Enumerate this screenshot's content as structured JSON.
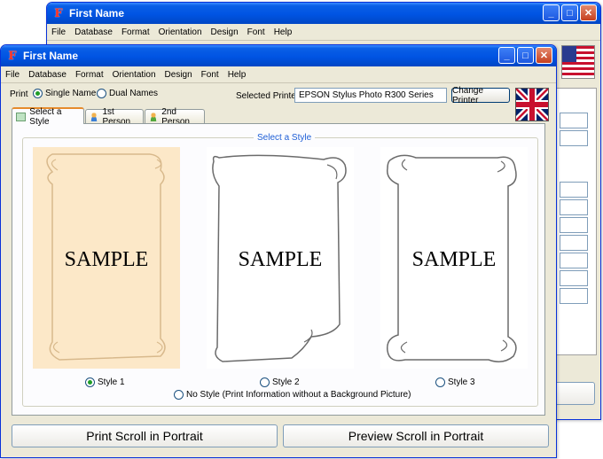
{
  "back_window": {
    "title": "First Name",
    "menu": [
      "File",
      "Database",
      "Format",
      "Orientation",
      "Design",
      "Font",
      "Help"
    ]
  },
  "front_window": {
    "title": "First Name",
    "menu": [
      "File",
      "Database",
      "Format",
      "Orientation",
      "Design",
      "Font",
      "Help"
    ],
    "print_label": "Print",
    "print_options": [
      "Single Name",
      "Dual Names"
    ],
    "print_selected": "Single Name",
    "printer_label": "Selected Printer",
    "printer_value": "EPSON Stylus Photo R300 Series",
    "change_printer": "Change Printer",
    "tabs": [
      "Select a Style",
      "1st Person",
      "2nd Person"
    ],
    "active_tab": "Select a Style",
    "group_title": "Select a Style",
    "styles": [
      {
        "label": "Style 1",
        "sample": "SAMPLE",
        "selected": true
      },
      {
        "label": "Style 2",
        "sample": "SAMPLE",
        "selected": false
      },
      {
        "label": "Style 3",
        "sample": "SAMPLE",
        "selected": false
      }
    ],
    "no_style": "No Style (Print Information without a Background Picture)",
    "print_button": "Print Scroll in Portrait",
    "preview_button": "Preview Scroll in Portrait"
  },
  "colors": {
    "title_blue": "#0054e3",
    "selected_card": "#fce8c8",
    "tab_accent": "#e68b2c",
    "group_title": "#1f5fd6"
  }
}
